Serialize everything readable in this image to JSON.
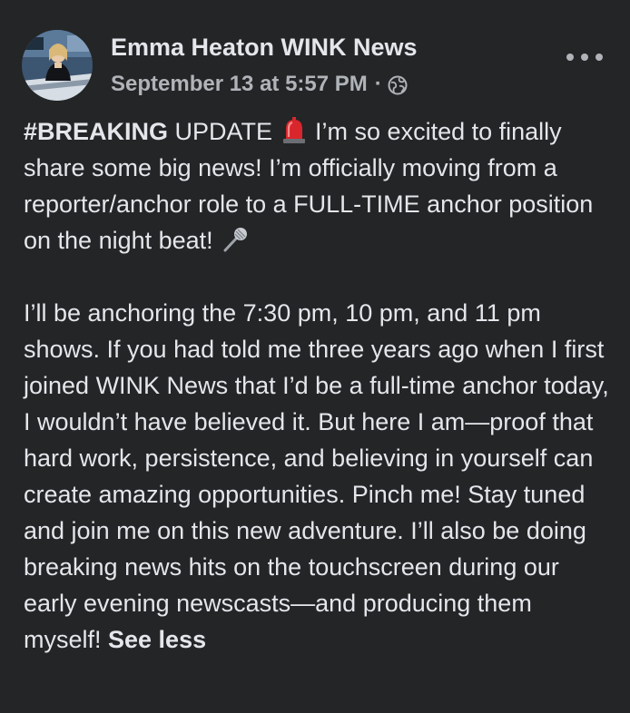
{
  "post": {
    "author": "Emma Heaton WINK News",
    "timestamp": "September 13 at 5:57 PM",
    "separator": "·",
    "privacy_icon": "globe-icon",
    "more_icon": "more-dots-icon",
    "avatar_icon": "profile-avatar",
    "paragraph1": {
      "hashtag": "#BREAKING",
      "part1": " UPDATE ",
      "emoji1": "police-light-emoji",
      "part2": " I’m so excited to finally share some big news! I’m officially moving from a reporter/anchor role to a FULL-TIME anchor position on the night beat! ",
      "emoji2": "microphone-emoji"
    },
    "paragraph2": {
      "text": "I’ll be anchoring the 7:30 pm, 10 pm, and 11 pm shows. If you had told me three years ago when I first joined WINK News that I’d be a full-time anchor today, I wouldn’t have believed it. But here I am—proof that hard work, persistence, and believing in yourself can create amazing opportunities. Pinch me! Stay tuned and join me on this new adventure. I’ll also be doing breaking news hits on the touchscreen during our early evening newscasts—and producing them myself! ",
      "see_less": "See less"
    }
  },
  "colors": {
    "background": "#242526",
    "primary_text": "#e4e6eb",
    "secondary_text": "#b0b3b8"
  }
}
